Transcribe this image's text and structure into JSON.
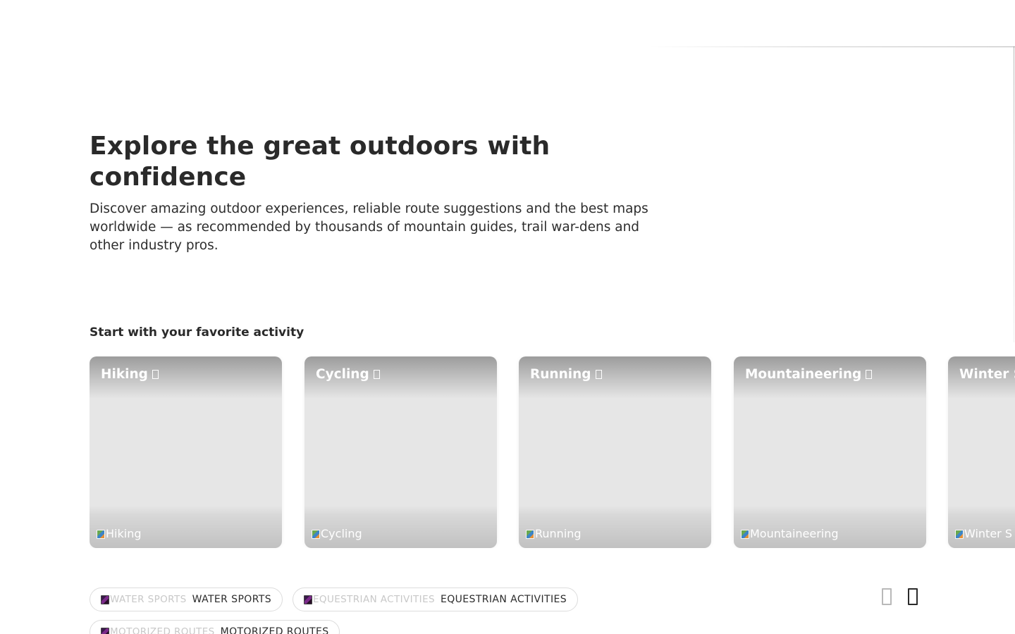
{
  "hero": {
    "title": "Explore the great outdoors with confidence",
    "subtitle": "Discover amazing outdoor experiences, reliable route suggestions and the best maps worldwide — as recommended by thousands of mountain guides, trail war-dens and other industry pros."
  },
  "activities": {
    "section_title": "Start with your favorite activity",
    "cards": [
      {
        "title": "Hiking",
        "image_alt": "Hiking",
        "icon": "arrow-right-icon"
      },
      {
        "title": "Cycling",
        "image_alt": "Cycling",
        "icon": "arrow-right-icon"
      },
      {
        "title": "Running",
        "image_alt": "Running",
        "icon": "arrow-right-icon"
      },
      {
        "title": "Mountaineering",
        "image_alt": "Mountaineering",
        "icon": "arrow-right-icon"
      },
      {
        "title": "Winter S",
        "image_alt": "Winter S",
        "icon": "arrow-right-icon"
      }
    ],
    "pills": [
      {
        "image_alt": "WATER SPORTS",
        "label": "WATER SPORTS"
      },
      {
        "image_alt": "EQUESTRIAN ACTIVITIES",
        "label": "EQUESTRIAN ACTIVITIES"
      },
      {
        "image_alt": "MOTORIZED ROUTES",
        "label": "MOTORIZED ROUTES"
      }
    ],
    "carousel": {
      "prev_icon": "chevron-left-icon",
      "next_icon": "chevron-right-icon"
    }
  }
}
